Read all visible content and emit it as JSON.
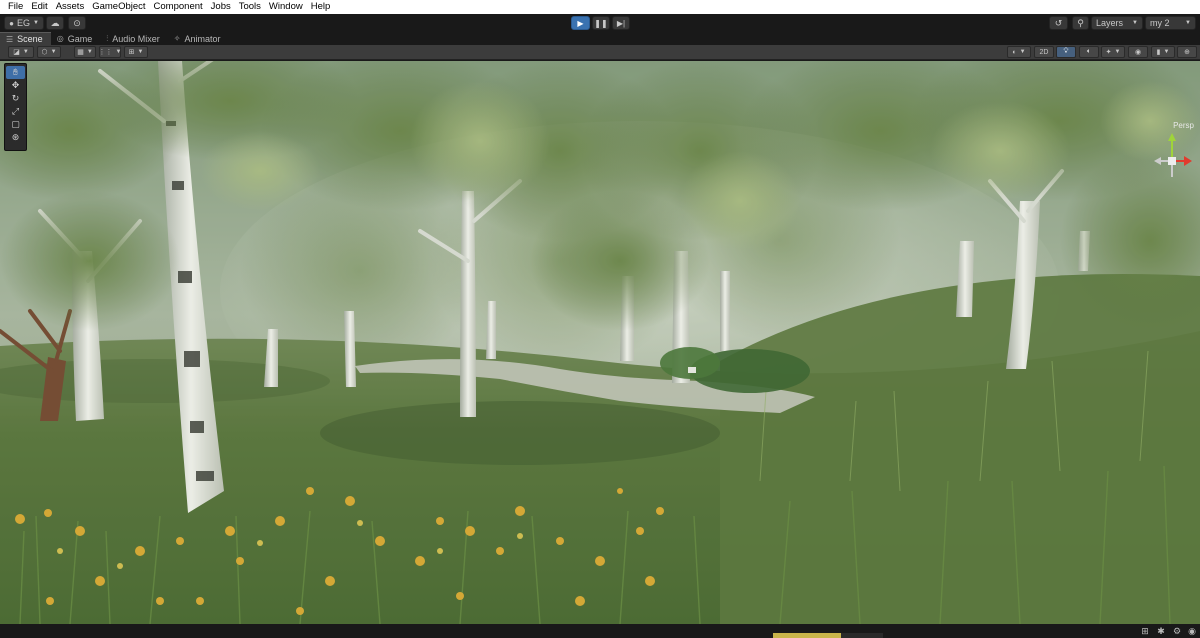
{
  "menu": [
    "File",
    "Edit",
    "Assets",
    "GameObject",
    "Component",
    "Jobs",
    "Tools",
    "Window",
    "Help"
  ],
  "toolbar": {
    "account": "EG",
    "layers": "Layers",
    "layout": "my 2"
  },
  "tabs": [
    {
      "label": "Scene",
      "icon": "scene-icon"
    },
    {
      "label": "Game",
      "icon": "game-controller-icon"
    },
    {
      "label": "Audio Mixer",
      "icon": "audio-mixer-icon"
    },
    {
      "label": "Animator",
      "icon": "animator-icon"
    }
  ],
  "scene_toolbar": {
    "mode_2d": "2D"
  },
  "tools": [
    "hand-icon",
    "move-icon",
    "rotate-icon",
    "scale-icon",
    "rect-icon",
    "transform-icon"
  ],
  "gizmo": {
    "label": "Persp"
  },
  "status": {
    "progress": 0.62
  },
  "colors": {
    "accent": "#3a72b0",
    "menubar": "#ffffff",
    "panel": "#3c3c3c"
  }
}
